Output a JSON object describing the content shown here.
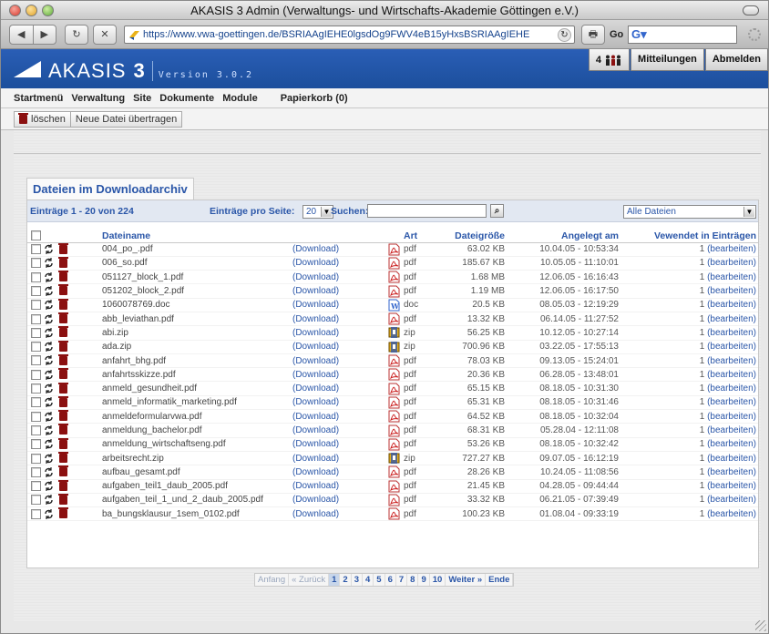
{
  "window": {
    "title": "AKASIS 3 Admin (Verwaltungs- und Wirtschafts-Akademie Göttingen e.V.)"
  },
  "toolbar": {
    "back": "◀",
    "forward": "▶",
    "reload": "↻",
    "stop": "✕",
    "url": "https://www.vwa-goettingen.de/BSRIAAgIEHE0lgsdOg9FWV4eB15yHxsBSRIAAgIEHE",
    "print": "🖶",
    "go_label": "Go",
    "google_label": "G▾"
  },
  "app": {
    "name": "AKASIS",
    "number": "3",
    "version": "Version 3.0.2",
    "users_count": "4",
    "messages": "Mitteilungen",
    "logout": "Abmelden",
    "brand_color": "#1f52a3"
  },
  "menu": [
    "Startmenü",
    "Verwaltung",
    "Site",
    "Dokumente",
    "Module",
    "Papierkorb (0)"
  ],
  "actions": {
    "delete": "löschen",
    "upload": "Neue Datei übertragen"
  },
  "section_title": "Dateien im Downloadarchiv",
  "filter": {
    "count": "Einträge 1 - 20 von 224",
    "per_page_label": "Einträge pro Seite:",
    "per_page_value": "20",
    "search_label": "Suchen:",
    "search_value": "",
    "file_filter": "Alle Dateien"
  },
  "columns": {
    "name": "Dateiname",
    "type": "Art",
    "size": "Dateigröße",
    "created": "Angelegt am",
    "used": "Vewendet in Einträgen"
  },
  "rows": [
    {
      "name": "004_po_.pdf",
      "download": "(Download)",
      "type": "pdf",
      "size": "63.02 KB",
      "created": "10.04.05 - 10:53:34",
      "used": "1",
      "edit": "(bearbeiten)"
    },
    {
      "name": "006_so.pdf",
      "download": "(Download)",
      "type": "pdf",
      "size": "185.67 KB",
      "created": "10.05.05 - 11:10:01",
      "used": "1",
      "edit": "(bearbeiten)"
    },
    {
      "name": "051127_block_1.pdf",
      "download": "(Download)",
      "type": "pdf",
      "size": "1.68 MB",
      "created": "12.06.05 - 16:16:43",
      "used": "1",
      "edit": "(bearbeiten)"
    },
    {
      "name": "051202_block_2.pdf",
      "download": "(Download)",
      "type": "pdf",
      "size": "1.19 MB",
      "created": "12.06.05 - 16:17:50",
      "used": "1",
      "edit": "(bearbeiten)"
    },
    {
      "name": "1060078769.doc",
      "download": "(Download)",
      "type": "doc",
      "size": "20.5 KB",
      "created": "08.05.03 - 12:19:29",
      "used": "1",
      "edit": "(bearbeiten)"
    },
    {
      "name": "abb_leviathan.pdf",
      "download": "(Download)",
      "type": "pdf",
      "size": "13.32 KB",
      "created": "06.14.05 - 11:27:52",
      "used": "1",
      "edit": "(bearbeiten)"
    },
    {
      "name": "abi.zip",
      "download": "(Download)",
      "type": "zip",
      "size": "56.25 KB",
      "created": "10.12.05 - 10:27:14",
      "used": "1",
      "edit": "(bearbeiten)"
    },
    {
      "name": "ada.zip",
      "download": "(Download)",
      "type": "zip",
      "size": "700.96 KB",
      "created": "03.22.05 - 17:55:13",
      "used": "1",
      "edit": "(bearbeiten)"
    },
    {
      "name": "anfahrt_bhg.pdf",
      "download": "(Download)",
      "type": "pdf",
      "size": "78.03 KB",
      "created": "09.13.05 - 15:24:01",
      "used": "1",
      "edit": "(bearbeiten)"
    },
    {
      "name": "anfahrtsskizze.pdf",
      "download": "(Download)",
      "type": "pdf",
      "size": "20.36 KB",
      "created": "06.28.05 - 13:48:01",
      "used": "1",
      "edit": "(bearbeiten)"
    },
    {
      "name": "anmeld_gesundheit.pdf",
      "download": "(Download)",
      "type": "pdf",
      "size": "65.15 KB",
      "created": "08.18.05 - 10:31:30",
      "used": "1",
      "edit": "(bearbeiten)"
    },
    {
      "name": "anmeld_informatik_marketing.pdf",
      "download": "(Download)",
      "type": "pdf",
      "size": "65.31 KB",
      "created": "08.18.05 - 10:31:46",
      "used": "1",
      "edit": "(bearbeiten)"
    },
    {
      "name": "anmeldeformularvwa.pdf",
      "download": "(Download)",
      "type": "pdf",
      "size": "64.52 KB",
      "created": "08.18.05 - 10:32:04",
      "used": "1",
      "edit": "(bearbeiten)"
    },
    {
      "name": "anmeldung_bachelor.pdf",
      "download": "(Download)",
      "type": "pdf",
      "size": "68.31 KB",
      "created": "05.28.04 - 12:11:08",
      "used": "1",
      "edit": "(bearbeiten)"
    },
    {
      "name": "anmeldung_wirtschaftseng.pdf",
      "download": "(Download)",
      "type": "pdf",
      "size": "53.26 KB",
      "created": "08.18.05 - 10:32:42",
      "used": "1",
      "edit": "(bearbeiten)"
    },
    {
      "name": "arbeitsrecht.zip",
      "download": "(Download)",
      "type": "zip",
      "size": "727.27 KB",
      "created": "09.07.05 - 16:12:19",
      "used": "1",
      "edit": "(bearbeiten)"
    },
    {
      "name": "aufbau_gesamt.pdf",
      "download": "(Download)",
      "type": "pdf",
      "size": "28.26 KB",
      "created": "10.24.05 - 11:08:56",
      "used": "1",
      "edit": "(bearbeiten)"
    },
    {
      "name": "aufgaben_teil1_daub_2005.pdf",
      "download": "(Download)",
      "type": "pdf",
      "size": "21.45 KB",
      "created": "04.28.05 - 09:44:44",
      "used": "1",
      "edit": "(bearbeiten)"
    },
    {
      "name": "aufgaben_teil_1_und_2_daub_2005.pdf",
      "download": "(Download)",
      "type": "pdf",
      "size": "33.32 KB",
      "created": "06.21.05 - 07:39:49",
      "used": "1",
      "edit": "(bearbeiten)"
    },
    {
      "name": "ba_bungsklausur_1sem_0102.pdf",
      "download": "(Download)",
      "type": "pdf",
      "size": "100.23 KB",
      "created": "01.08.04 - 09:33:19",
      "used": "1",
      "edit": "(bearbeiten)"
    }
  ],
  "pagination": {
    "first": "Anfang",
    "prev": "« Zurück",
    "pages": [
      "1",
      "2",
      "3",
      "4",
      "5",
      "6",
      "7",
      "8",
      "9",
      "10"
    ],
    "current": "1",
    "next": "Weiter »",
    "last": "Ende"
  }
}
